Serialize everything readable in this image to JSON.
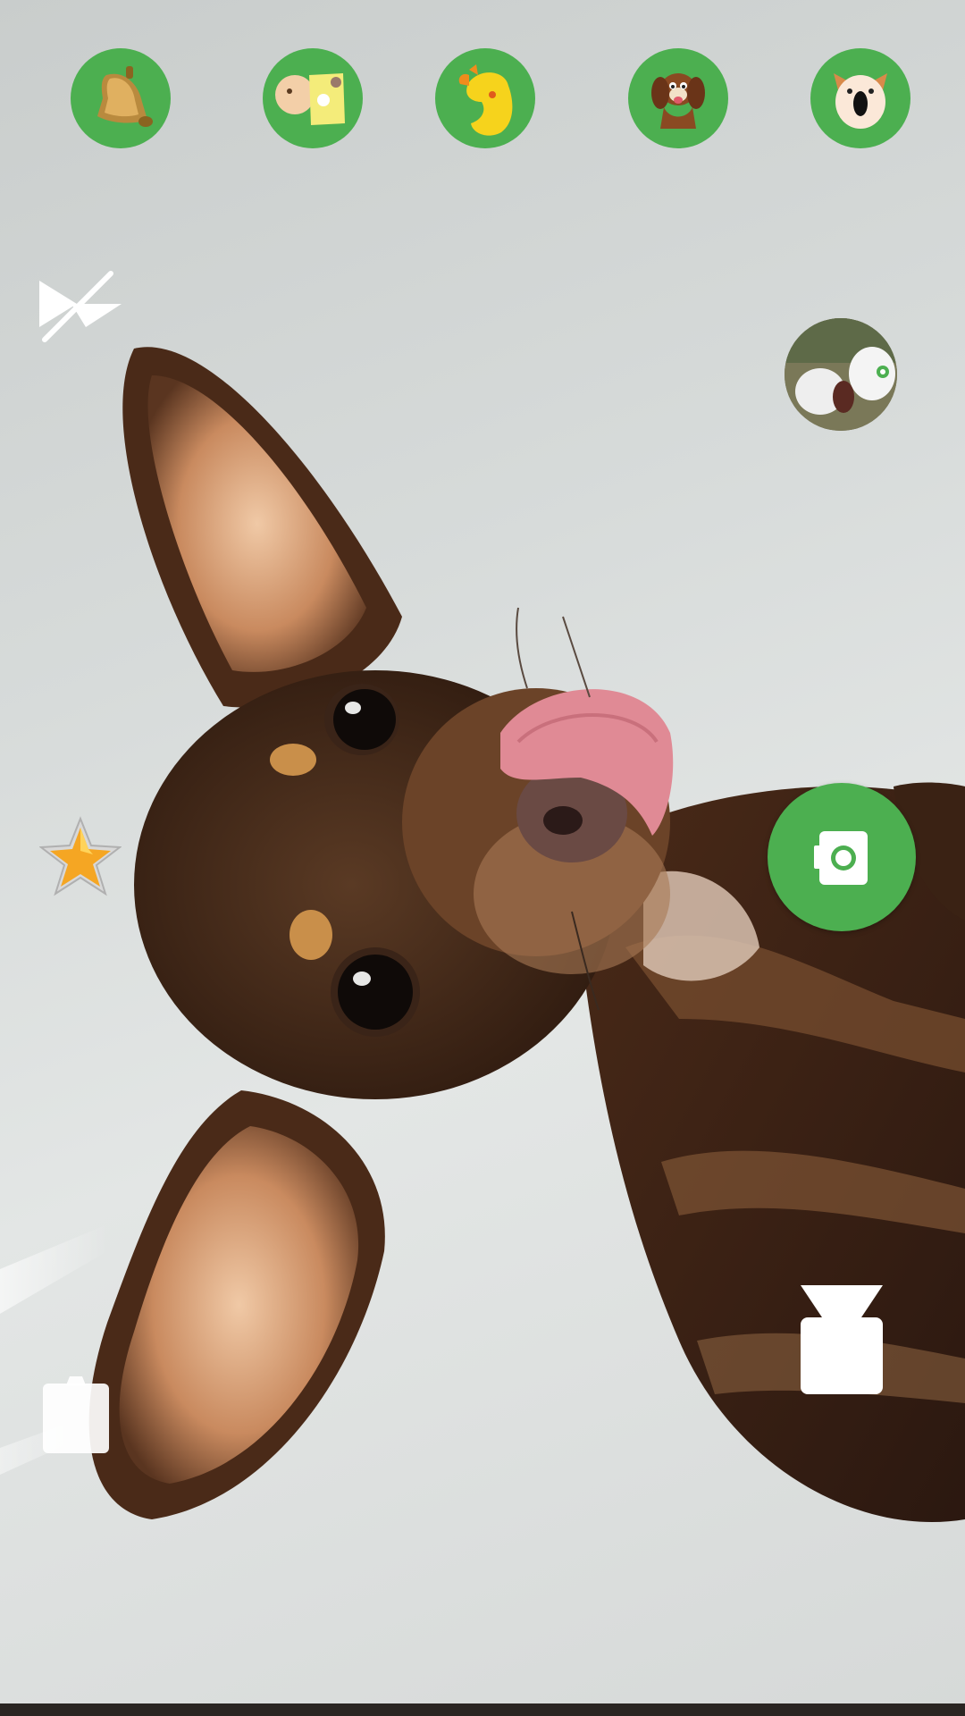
{
  "app": {
    "screen": "camera-viewfinder"
  },
  "sound_bar": {
    "items": [
      {
        "icon": "bell-icon"
      },
      {
        "icon": "baby-icon"
      },
      {
        "icon": "duck-icon"
      },
      {
        "icon": "puppy-icon"
      },
      {
        "icon": "dog-face-icon"
      }
    ]
  },
  "controls": {
    "flash_icon": "flash-off-icon",
    "favorite_icon": "star-icon",
    "capture_icon": "camera-icon",
    "switch_camera_icon": "switch-camera-icon",
    "share_icon": "share-icon",
    "gallery_icon": "gallery-thumbnail"
  },
  "colors": {
    "accent": "#4caf50",
    "icon_white": "#ffffff"
  }
}
